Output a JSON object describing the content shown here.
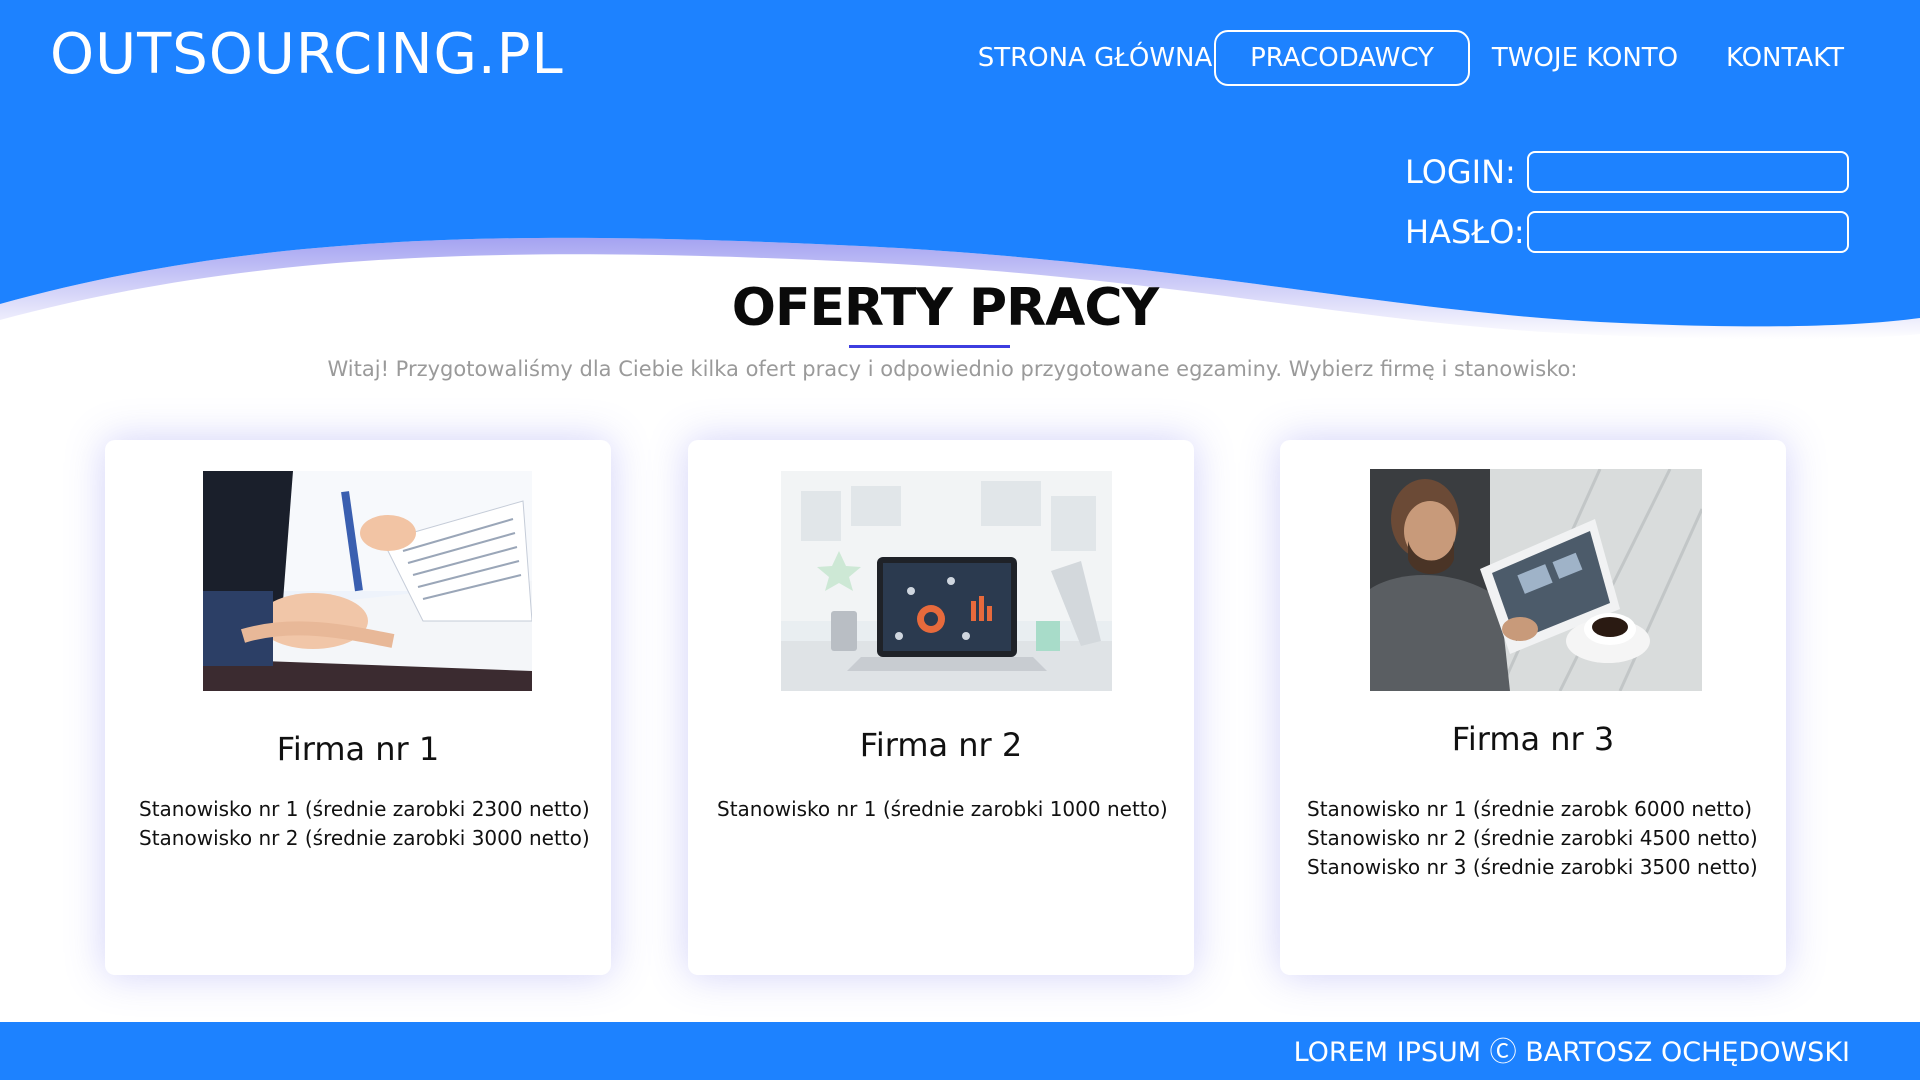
{
  "header": {
    "logo": "OUTSOURCING.PL",
    "nav": [
      {
        "label": "STRONA GŁÓWNA",
        "active": false
      },
      {
        "label": "PRACODAWCY",
        "active": true
      },
      {
        "label": "TWOJE KONTO",
        "active": false
      },
      {
        "label": "KONTAKT",
        "active": false
      }
    ]
  },
  "login": {
    "login_label": "LOGIN:",
    "login_value": "",
    "password_label": "HASŁO:",
    "password_value": ""
  },
  "main": {
    "title": "OFERTY PRACY",
    "intro": "Witaj! Przygotowaliśmy dla Ciebie kilka ofert pracy i odpowiednio przygotowane egzaminy. Wybierz firmę i stanowisko:"
  },
  "cards": [
    {
      "company": "Firma nr 1",
      "image": "business-documents-photo",
      "positions": [
        "Stanowisko nr 1 (średnie zarobki 2300 netto)",
        "Stanowisko nr 2 (średnie zarobki 3000 netto)"
      ]
    },
    {
      "company": "Firma nr 2",
      "image": "laptop-desk-photo",
      "positions": [
        "Stanowisko nr 1 (średnie zarobki 1000 netto)"
      ]
    },
    {
      "company": "Firma nr 3",
      "image": "man-with-tablet-photo",
      "positions": [
        "Stanowisko nr 1 (średnie zarobk 6000 netto)",
        "Stanowisko nr 2 (średnie zarobki 4500 netto)",
        "Stanowisko nr 3 (średnie zarobki 3500 netto)"
      ]
    }
  ],
  "footer": {
    "text": "LOREM IPSUM Ⓒ BARTOSZ OCHĘDOWSKI"
  },
  "colors": {
    "brand_blue": "#1d82ff",
    "accent_underline": "#3d3de0",
    "intro_text": "#9a9a9a"
  }
}
